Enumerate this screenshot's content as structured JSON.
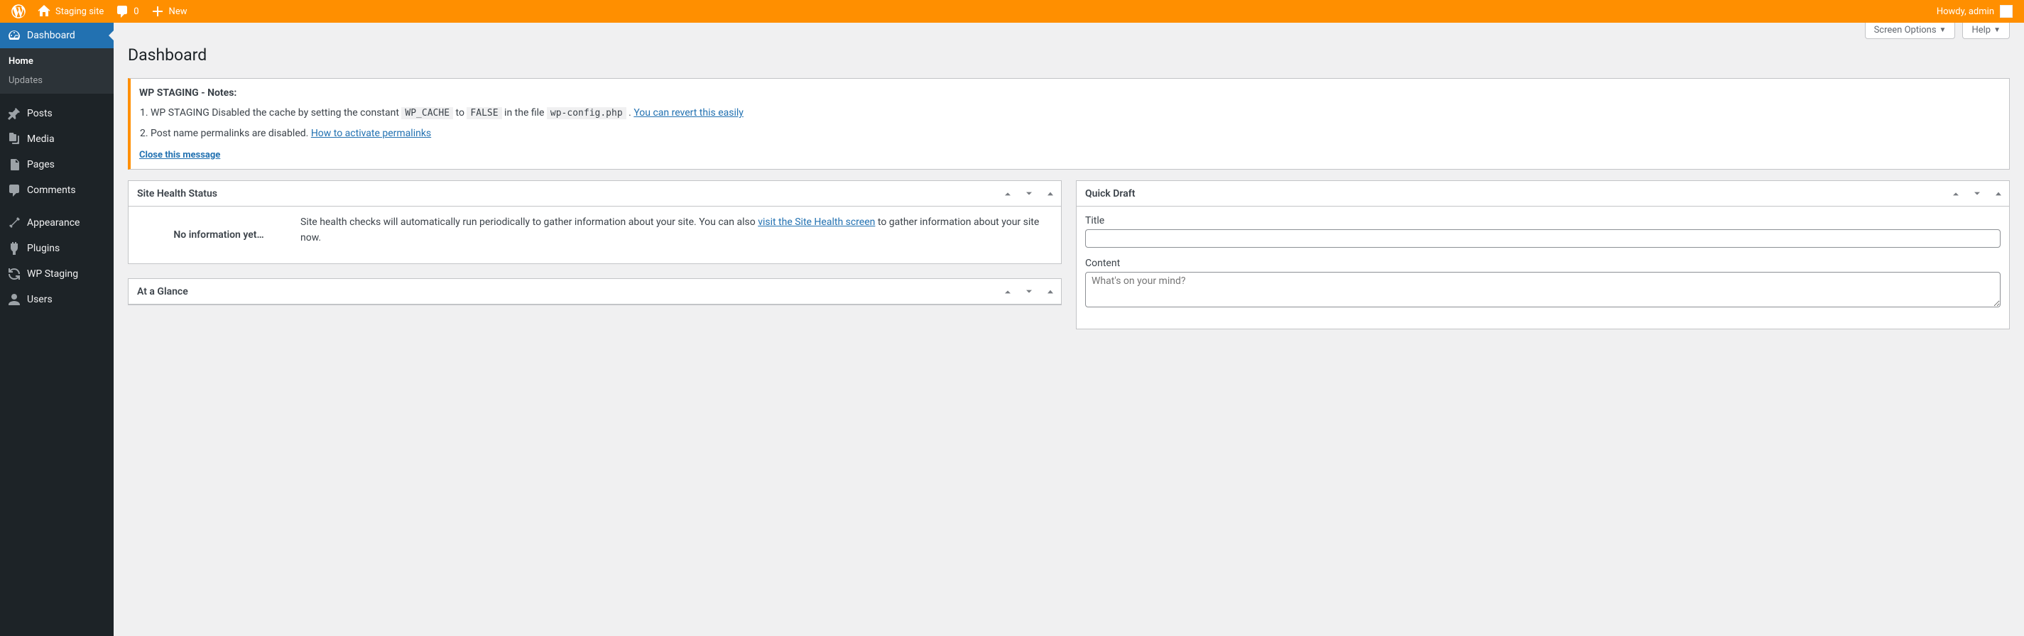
{
  "adminbar": {
    "site_name": "Staging site",
    "comments_count": "0",
    "new_label": "New",
    "howdy": "Howdy, admin"
  },
  "menu": {
    "dashboard": "Dashboard",
    "sub_home": "Home",
    "sub_updates": "Updates",
    "posts": "Posts",
    "media": "Media",
    "pages": "Pages",
    "comments": "Comments",
    "appearance": "Appearance",
    "plugins": "Plugins",
    "wpstaging": "WP Staging",
    "users": "Users"
  },
  "screen_meta": {
    "screen_options": "Screen Options",
    "help": "Help"
  },
  "page": {
    "title": "Dashboard"
  },
  "notice": {
    "title": "WP STAGING - Notes:",
    "item1_a": "WP STAGING Disabled the cache by setting the constant ",
    "item1_code1": "WP_CACHE",
    "item1_b": " to ",
    "item1_code2": "FALSE",
    "item1_c": " in the file ",
    "item1_code3": "wp-config.php",
    "item1_d": " . ",
    "item1_link": "You can revert this easily",
    "item2_a": "Post name permalinks are disabled. ",
    "item2_link": "How to activate permalinks",
    "close": "Close this message"
  },
  "site_health": {
    "title": "Site Health Status",
    "no_info": "No information yet…",
    "text_a": "Site health checks will automatically run periodically to gather information about your site. You can also ",
    "link": "visit the Site Health screen",
    "text_b": " to gather information about your site now."
  },
  "glance": {
    "title": "At a Glance"
  },
  "quickdraft": {
    "title": "Quick Draft",
    "label_title": "Title",
    "label_content": "Content",
    "placeholder": "What's on your mind?"
  }
}
